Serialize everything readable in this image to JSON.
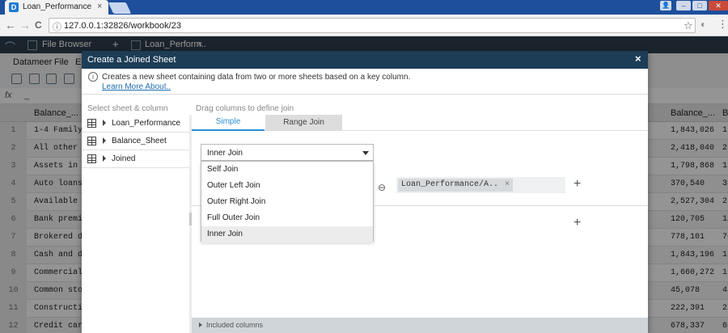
{
  "browser": {
    "tab_title": "Loan_Performance",
    "tab_favicon": "D",
    "tab_close": "×",
    "url": "127.0.0.1:32826/workbook/23",
    "back_icon": "←",
    "forward_icon": "→",
    "reload_icon": "C",
    "page_icon": "ⓘ",
    "star_icon": "☆",
    "menu_icon": "⋮",
    "win_minimize": "–",
    "win_maximize": "□",
    "win_close": "✕",
    "user_icon": "👤"
  },
  "app": {
    "tabs": [
      "File Browser",
      "+",
      "Loan_Perform..",
      "×"
    ],
    "menu": [
      "Datameer",
      "File",
      "E"
    ],
    "formula_label": "fx",
    "formula_value": "_",
    "grid_headers": {
      "left": "Balance_...",
      "right": "Balance_...",
      "far_right": "B"
    },
    "grid_rows": [
      {
        "n": "1",
        "a": "1-4 Family..",
        "b": "1,843,026",
        "c": "1,"
      },
      {
        "n": "2",
        "a": "All other ..",
        "b": "2,418,040",
        "c": "2,"
      },
      {
        "n": "3",
        "a": "Assets in ..",
        "b": "1,798,868",
        "c": "1,"
      },
      {
        "n": "4",
        "a": "Auto loans",
        "b": "370,540",
        "c": "35"
      },
      {
        "n": "5",
        "a": "Available ..",
        "b": "2,527,304",
        "c": "2,"
      },
      {
        "n": "6",
        "a": "Bank premi..",
        "b": "120,705",
        "c": "12"
      },
      {
        "n": "7",
        "a": "Brokered d..",
        "b": "778,101",
        "c": "76"
      },
      {
        "n": "8",
        "a": "Cash and d..",
        "b": "1,843,196",
        "c": "1,"
      },
      {
        "n": "9",
        "a": "Commercial..",
        "b": "1,660,272",
        "c": "1,"
      },
      {
        "n": "10",
        "a": "Common sto..",
        "b": "45,078",
        "c": "43"
      },
      {
        "n": "11",
        "a": "Constructi..",
        "b": "222,391",
        "c": "22"
      },
      {
        "n": "12",
        "a": "Credit car..",
        "b": "678,337",
        "c": "65"
      }
    ]
  },
  "dialog": {
    "title": "Create a Joined Sheet",
    "close": "×",
    "info_icon": "i",
    "info_text": "Creates a new sheet containing data from two or more sheets based on a key column.",
    "info_link": "Learn More About..",
    "left_heading": "Select sheet & column",
    "sheets": [
      {
        "label": "Loan_Performance"
      },
      {
        "label": "Balance_Sheet"
      },
      {
        "label": "Joined"
      }
    ],
    "right_heading": "Drag columns to define join",
    "tabs": {
      "simple": "Simple",
      "range": "Range Join"
    },
    "join_type": {
      "selected": "Inner Join",
      "options": [
        "Self Join",
        "Outer Left Join",
        "Outer Right Join",
        "Full Outer Join",
        "Inner Join"
      ]
    },
    "link_icon": "⊖",
    "key_chip": "Loan_Performance/A..",
    "chip_remove": "×",
    "add_icon": "+",
    "included_label": "Included columns"
  },
  "colors": {
    "accent": "#2a8dd4",
    "dialog_header": "#1d3c56",
    "chrome_frame": "#1d4f9c"
  }
}
